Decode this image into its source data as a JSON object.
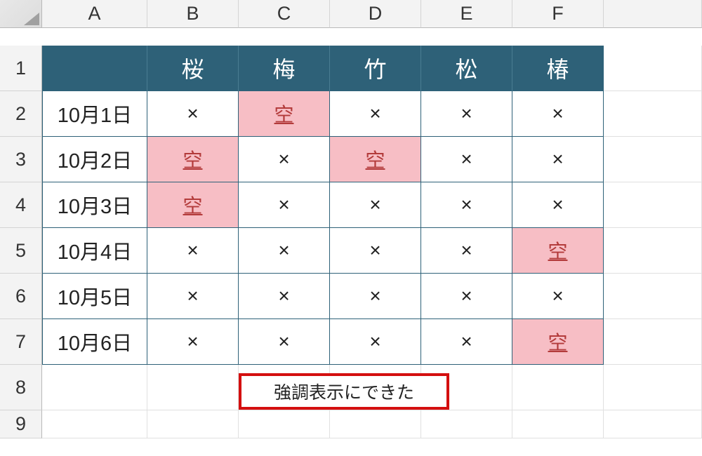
{
  "columns": [
    "A",
    "B",
    "C",
    "D",
    "E",
    "F",
    ""
  ],
  "rows": [
    "1",
    "2",
    "3",
    "4",
    "5",
    "6",
    "7",
    "8",
    "9"
  ],
  "header_row": [
    "",
    "桜",
    "梅",
    "竹",
    "松",
    "椿"
  ],
  "dates": [
    "10月1日",
    "10月2日",
    "10月3日",
    "10月4日",
    "10月5日",
    "10月6日"
  ],
  "mark_x": "×",
  "mark_empty": "空",
  "data": [
    [
      "x",
      "e",
      "x",
      "x",
      "x"
    ],
    [
      "e",
      "x",
      "e",
      "x",
      "x"
    ],
    [
      "e",
      "x",
      "x",
      "x",
      "x"
    ],
    [
      "x",
      "x",
      "x",
      "x",
      "e"
    ],
    [
      "x",
      "x",
      "x",
      "x",
      "x"
    ],
    [
      "x",
      "x",
      "x",
      "x",
      "e"
    ]
  ],
  "callout_text": "強調表示にできた"
}
